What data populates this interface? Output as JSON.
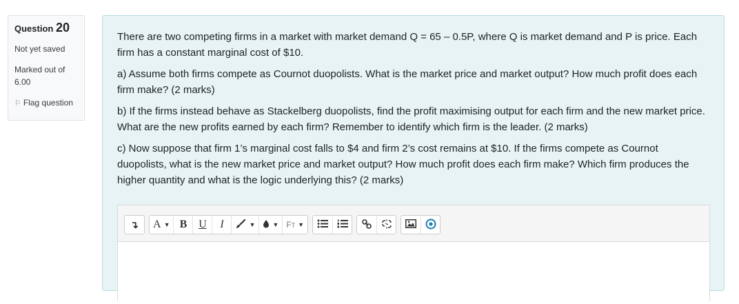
{
  "info": {
    "question_label": "Question",
    "question_number": "20",
    "state": "Not yet saved",
    "grade": "Marked out of 6.00",
    "flag_label": "Flag question"
  },
  "question": {
    "paragraphs": [
      "There are two competing firms in a market with market demand Q = 65 – 0.5P, where Q is market demand and P is price. Each firm has a constant marginal cost of $10.",
      "a) Assume both firms compete as Cournot duopolists. What is the market price and market output? How much profit does each firm make? (2 marks)",
      "b) If the firms instead behave as Stackelberg duopolists, find the profit maximising output for each firm and the new market price. What are the new profits earned by each firm? Remember to identify which firm is the leader. (2 marks)",
      "c) Now suppose that firm 1’s marginal cost falls to $4 and firm 2’s cost remains at $10. If the firms compete as Cournot duopolists, what is the new market price and market output? How much profit does each firm make? Which firm produces the higher quantity and what is the logic underlying this?  (2 marks)"
    ]
  },
  "toolbar": {
    "collapse_icon": "↴",
    "style_label": "A",
    "bold_label": "B",
    "underline_label": "U",
    "italic_label": "I",
    "font_label": "F",
    "icons": [
      "collapse-icon",
      "text-style-icon",
      "bold-icon",
      "underline-icon",
      "italic-icon",
      "brush-icon",
      "ink-drop-icon",
      "font-family-icon",
      "bullet-list-icon",
      "numbered-list-icon",
      "link-icon",
      "unlink-icon",
      "image-icon",
      "record-icon"
    ]
  }
}
